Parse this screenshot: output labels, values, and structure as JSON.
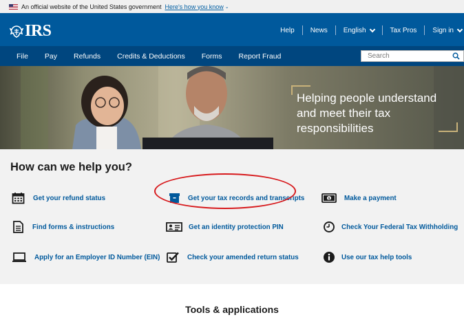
{
  "gov_banner": {
    "text": "An official website of the United States government",
    "link": "Here's how you know"
  },
  "header": {
    "logo_text": "IRS",
    "utility_nav": [
      {
        "label": "Help"
      },
      {
        "label": "News"
      },
      {
        "label": "English"
      },
      {
        "label": "Tax Pros"
      },
      {
        "label": "Sign in"
      }
    ]
  },
  "nav": {
    "items": [
      "File",
      "Pay",
      "Refunds",
      "Credits & Deductions",
      "Forms",
      "Report Fraud"
    ],
    "search_placeholder": "Search"
  },
  "hero": {
    "title": "Helping people understand and meet their tax responsibilities"
  },
  "help": {
    "title": "How can we help you?",
    "items": [
      {
        "label": "Get your refund status",
        "icon": "calendar-icon"
      },
      {
        "label": "Get your tax records and transcripts",
        "icon": "archive-box-icon"
      },
      {
        "label": "Make a payment",
        "icon": "dollar-bill-icon"
      },
      {
        "label": "Find forms & instructions",
        "icon": "document-icon"
      },
      {
        "label": "Get an identity protection PIN",
        "icon": "id-card-icon"
      },
      {
        "label": "Check Your Federal Tax Withholding",
        "icon": "clock-icon"
      },
      {
        "label": "Apply for an Employer ID Number (EIN)",
        "icon": "laptop-icon"
      },
      {
        "label": "Check your amended return status",
        "icon": "checkbox-icon"
      },
      {
        "label": "Use our tax help tools",
        "icon": "info-icon"
      }
    ]
  },
  "tools": {
    "title": "Tools & applications"
  },
  "colors": {
    "header_blue": "#00599c",
    "nav_blue": "#00467f",
    "link_blue": "#00599c",
    "highlight_red": "#d7191c",
    "section_gray": "#f2f2f2"
  }
}
